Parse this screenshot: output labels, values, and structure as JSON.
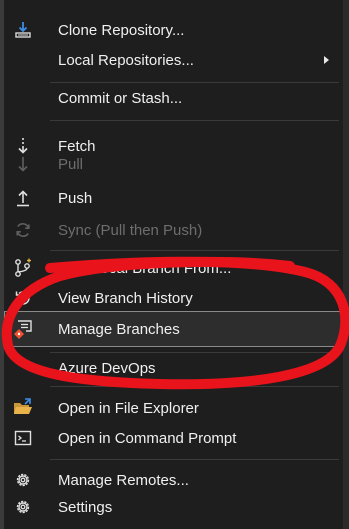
{
  "menu": {
    "items": [
      {
        "label": "Clone Repository...",
        "icon": "clone-icon"
      },
      {
        "label": "Local Repositories...",
        "icon": "",
        "submenu": true
      },
      {
        "label": "Commit or Stash...",
        "icon": ""
      },
      {
        "label": "Fetch",
        "icon": "fetch-icon"
      },
      {
        "label": "Pull",
        "icon": "pull-icon",
        "disabled": true
      },
      {
        "label": "Push",
        "icon": "push-icon"
      },
      {
        "label": "Sync (Pull then Push)",
        "icon": "sync-icon",
        "disabled": true
      },
      {
        "label": "New Local Branch From...",
        "icon": "new-branch-icon"
      },
      {
        "label": "View Branch History",
        "icon": "history-icon"
      },
      {
        "label": "Manage Branches",
        "icon": "manage-branches-icon",
        "selected": true
      },
      {
        "label": "Azure DevOps",
        "icon": ""
      },
      {
        "label": "Open in File Explorer",
        "icon": "folder-open-icon"
      },
      {
        "label": "Open in Command Prompt",
        "icon": "terminal-icon"
      },
      {
        "label": "Manage Remotes...",
        "icon": "gear-icon"
      },
      {
        "label": "Settings",
        "icon": "gear-icon"
      }
    ]
  },
  "colors": {
    "background": "#1e1e1e",
    "text": "#f0f0f0",
    "disabled_text": "#6d6d6d",
    "annotation": "#e8131b",
    "accent_blue": "#3c8ee6",
    "git_orange": "#f05133",
    "folder_yellow": "#e8b44a"
  }
}
